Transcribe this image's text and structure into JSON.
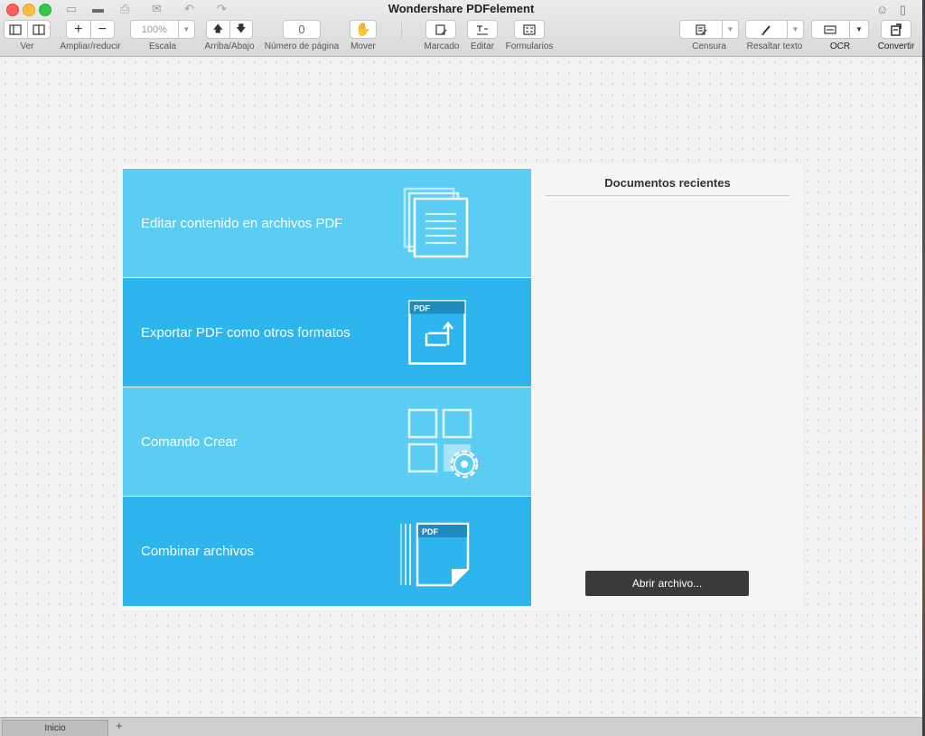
{
  "window": {
    "title": "Wondershare PDFelement"
  },
  "toolbar": {
    "view_label": "Ver",
    "zoom_label": "Ampliar/reducir",
    "zoom_in": "+",
    "zoom_out": "−",
    "scale_label": "Escala",
    "scale_value": "100%",
    "updown_label": "Arriba/Abajo",
    "page_label": "Número de página",
    "page_value": "0",
    "move_label": "Mover",
    "mark_label": "Marcado",
    "edit_label": "Editar",
    "forms_label": "Formularios",
    "redact_label": "Censura",
    "highlight_label": "Resaltar texto",
    "ocr_label": "OCR",
    "convert_label": "Convertir"
  },
  "tiles": [
    {
      "label": "Editar contenido en archivos PDF",
      "color": "#5bcdf3",
      "icon": "document-stack-icon"
    },
    {
      "label": "Exportar PDF como otros formatos",
      "color": "#2eb5ee",
      "icon": "pdf-convert-icon"
    },
    {
      "label": "Comando Crear",
      "color": "#5bcdf3",
      "icon": "grid-gear-icon"
    },
    {
      "label": "Combinar archivos",
      "color": "#2eb5ee",
      "icon": "pdf-combine-icon"
    }
  ],
  "icon_text": {
    "pdf": "PDF"
  },
  "recent": {
    "title": "Documentos recientes",
    "open_button": "Abrir archivo..."
  },
  "tabs": [
    {
      "label": "Inicio"
    }
  ],
  "tab_add": "+"
}
